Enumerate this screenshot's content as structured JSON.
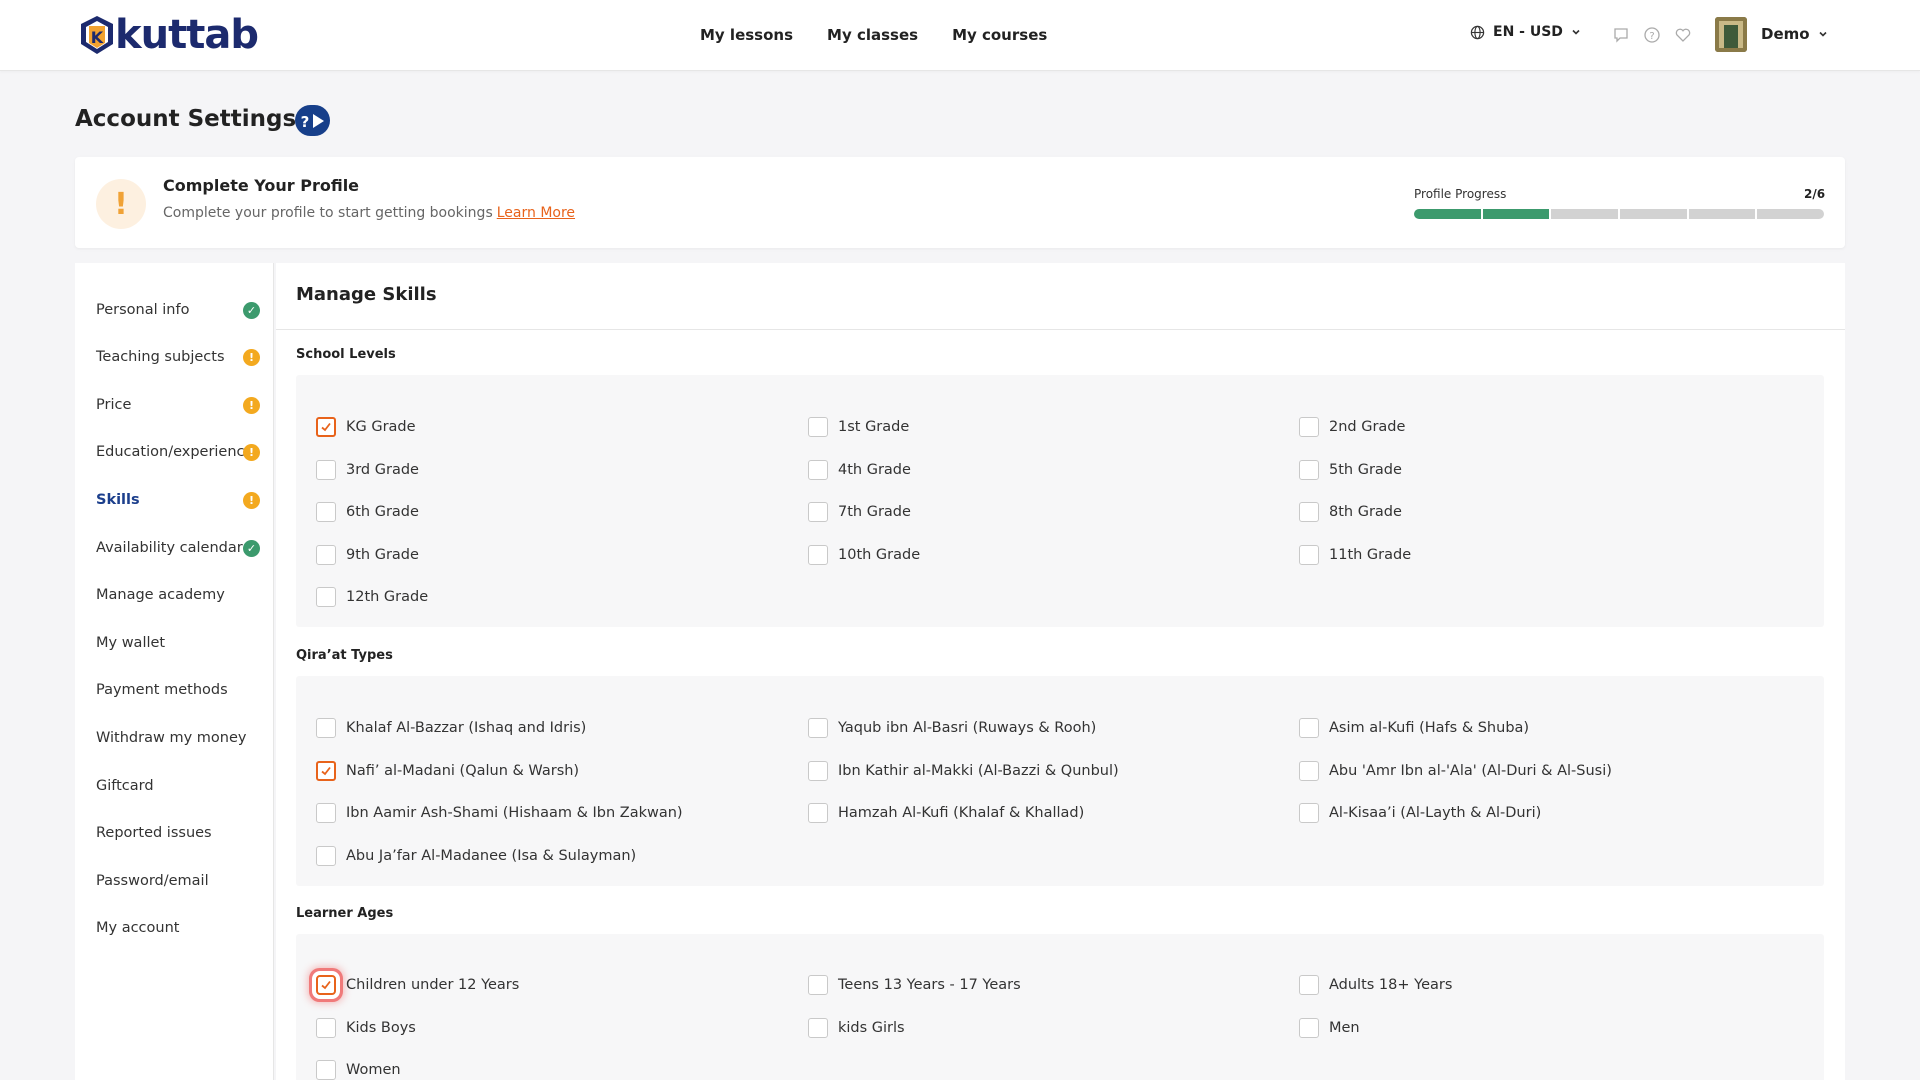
{
  "header": {
    "logo_text": "kuttab",
    "nav": [
      "My lessons",
      "My classes",
      "My courses"
    ],
    "lang": "EN - USD",
    "user": "Demo"
  },
  "page": {
    "title": "Account Settings"
  },
  "profile": {
    "title": "Complete Your Profile",
    "subtitle": "Complete your profile to start getting bookings",
    "learn_more": "Learn More",
    "progress_label": "Profile Progress",
    "progress_text": "2/6",
    "progress_done": 2,
    "progress_total": 6
  },
  "sidebar": {
    "items": [
      {
        "label": "Personal info",
        "status": "ok"
      },
      {
        "label": "Teaching subjects",
        "status": "warn"
      },
      {
        "label": "Price",
        "status": "warn"
      },
      {
        "label": "Education/experience",
        "status": "warn"
      },
      {
        "label": "Skills",
        "status": "warn",
        "active": true
      },
      {
        "label": "Availability calendar",
        "status": "ok"
      },
      {
        "label": "Manage academy"
      },
      {
        "label": "My wallet"
      },
      {
        "label": "Payment methods"
      },
      {
        "label": "Withdraw my money"
      },
      {
        "label": "Giftcard"
      },
      {
        "label": "Reported issues"
      },
      {
        "label": "Password/email"
      },
      {
        "label": "My account"
      }
    ]
  },
  "main": {
    "title": "Manage Skills",
    "sections": [
      {
        "title": "School Levels",
        "options": [
          {
            "label": "KG Grade",
            "checked": true
          },
          {
            "label": "1st Grade",
            "checked": false
          },
          {
            "label": "2nd Grade",
            "checked": false
          },
          {
            "label": "3rd Grade",
            "checked": false
          },
          {
            "label": "4th Grade",
            "checked": false
          },
          {
            "label": "5th Grade",
            "checked": false
          },
          {
            "label": "6th Grade",
            "checked": false
          },
          {
            "label": "7th Grade",
            "checked": false
          },
          {
            "label": "8th Grade",
            "checked": false
          },
          {
            "label": "9th Grade",
            "checked": false
          },
          {
            "label": "10th Grade",
            "checked": false
          },
          {
            "label": "11th Grade",
            "checked": false
          },
          {
            "label": "12th Grade",
            "checked": false
          }
        ]
      },
      {
        "title": "Qira’at Types",
        "options": [
          {
            "label": "Khalaf Al-Bazzar (Ishaq and Idris)",
            "checked": false
          },
          {
            "label": "Yaqub ibn Al-Basri (Ruways & Rooh)",
            "checked": false
          },
          {
            "label": "Asim al-Kufi (Hafs & Shuba)",
            "checked": false
          },
          {
            "label": "Nafi’ al-Madani (Qalun & Warsh)",
            "checked": true
          },
          {
            "label": "Ibn Kathir al-Makki (Al-Bazzi & Qunbul)",
            "checked": false
          },
          {
            "label": "Abu 'Amr Ibn al-'Ala' (Al-Duri & Al-Susi)",
            "checked": false
          },
          {
            "label": "Ibn Aamir Ash-Shami (Hishaam & Ibn Zakwan)",
            "checked": false
          },
          {
            "label": "Hamzah Al-Kufi (Khalaf & Khallad)",
            "checked": false
          },
          {
            "label": "Al-Kisaa’i (Al-Layth & Al-Duri)",
            "checked": false
          },
          {
            "label": "Abu Ja’far Al-Madanee (Isa & Sulayman)",
            "checked": false
          }
        ]
      },
      {
        "title": "Learner Ages",
        "options": [
          {
            "label": "Children under 12 Years",
            "checked": true,
            "focused": true
          },
          {
            "label": "Teens 13 Years - 17 Years",
            "checked": false
          },
          {
            "label": "Adults 18+ Years",
            "checked": false
          },
          {
            "label": "Kids Boys",
            "checked": false
          },
          {
            "label": "kids Girls",
            "checked": false
          },
          {
            "label": "Men",
            "checked": false
          },
          {
            "label": "Women",
            "checked": false
          }
        ]
      }
    ]
  },
  "colors": {
    "brand_navy": "#1c2a6e",
    "accent_orange": "#e8631b",
    "success_green": "#3c9a6d",
    "warning_yellow": "#f3a91f"
  }
}
